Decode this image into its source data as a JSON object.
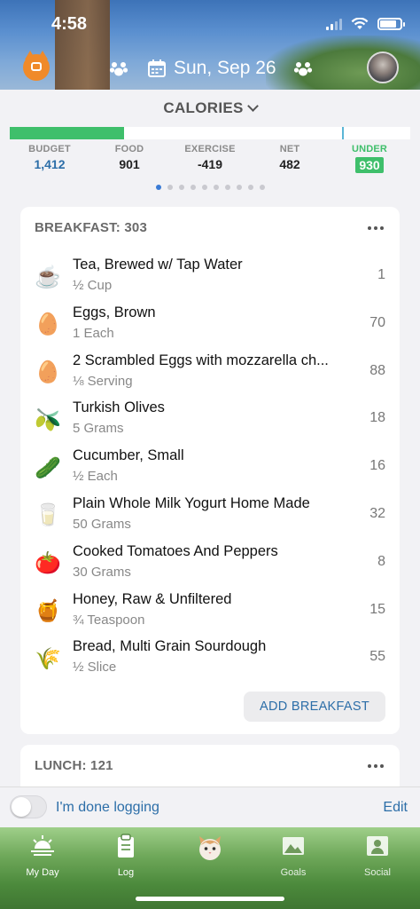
{
  "status": {
    "time": "4:58"
  },
  "header": {
    "date": "Sun, Sep 26"
  },
  "summary": {
    "title": "CALORIES",
    "budget_progress": 0.285,
    "labels": {
      "budget": "BUDGET",
      "food": "FOOD",
      "exercise": "EXERCISE",
      "net": "NET",
      "under": "UNDER"
    },
    "values": {
      "budget": "1,412",
      "food": "901",
      "exercise": "-419",
      "net": "482",
      "under": "930"
    },
    "page_dots": 10,
    "active_dot": 0
  },
  "breakfast": {
    "title": "BREAKFAST: 303",
    "items": [
      {
        "icon": "tea-icon",
        "glyph": "☕",
        "name": "Tea, Brewed w/ Tap Water",
        "portion": "½ Cup",
        "cals": "1"
      },
      {
        "icon": "egg-icon",
        "glyph": "🥚",
        "name": "Eggs, Brown",
        "portion": "1 Each",
        "cals": "70"
      },
      {
        "icon": "egg-icon",
        "glyph": "🥚",
        "name": "2 Scrambled Eggs with mozzarella ch...",
        "portion": "⅛ Serving",
        "cals": "88"
      },
      {
        "icon": "olive-icon",
        "glyph": "🫒",
        "name": "Turkish Olives",
        "portion": "5 Grams",
        "cals": "18"
      },
      {
        "icon": "cucumber-icon",
        "glyph": "🥒",
        "name": "Cucumber, Small",
        "portion": "½ Each",
        "cals": "16"
      },
      {
        "icon": "yogurt-icon",
        "glyph": "🥛",
        "name": "Plain Whole Milk Yogurt Home Made",
        "portion": "50 Grams",
        "cals": "32"
      },
      {
        "icon": "tomato-icon",
        "glyph": "🍅",
        "name": "Cooked Tomatoes And Peppers",
        "portion": "30 Grams",
        "cals": "8"
      },
      {
        "icon": "honey-icon",
        "glyph": "🍯",
        "name": "Honey, Raw & Unfiltered",
        "portion": "¾ Teaspoon",
        "cals": "15"
      },
      {
        "icon": "grain-icon",
        "glyph": "🌾",
        "name": "Bread, Multi Grain Sourdough",
        "portion": "½ Slice",
        "cals": "55"
      }
    ],
    "add_label": "ADD BREAKFAST"
  },
  "lunch": {
    "title": "LUNCH: 121"
  },
  "done_bar": {
    "label": "I'm done logging",
    "edit": "Edit"
  },
  "tabs": [
    {
      "label": "My Day",
      "icon": "sunrise-icon"
    },
    {
      "label": "Log",
      "icon": "clipboard-icon"
    },
    {
      "label": "",
      "icon": "cat-face-icon"
    },
    {
      "label": "Goals",
      "icon": "mountain-icon"
    },
    {
      "label": "Social",
      "icon": "people-icon"
    }
  ],
  "colors": {
    "accent": "#2c6ea8",
    "progress": "#3fbf6b",
    "marker": "#5bb6d6"
  }
}
